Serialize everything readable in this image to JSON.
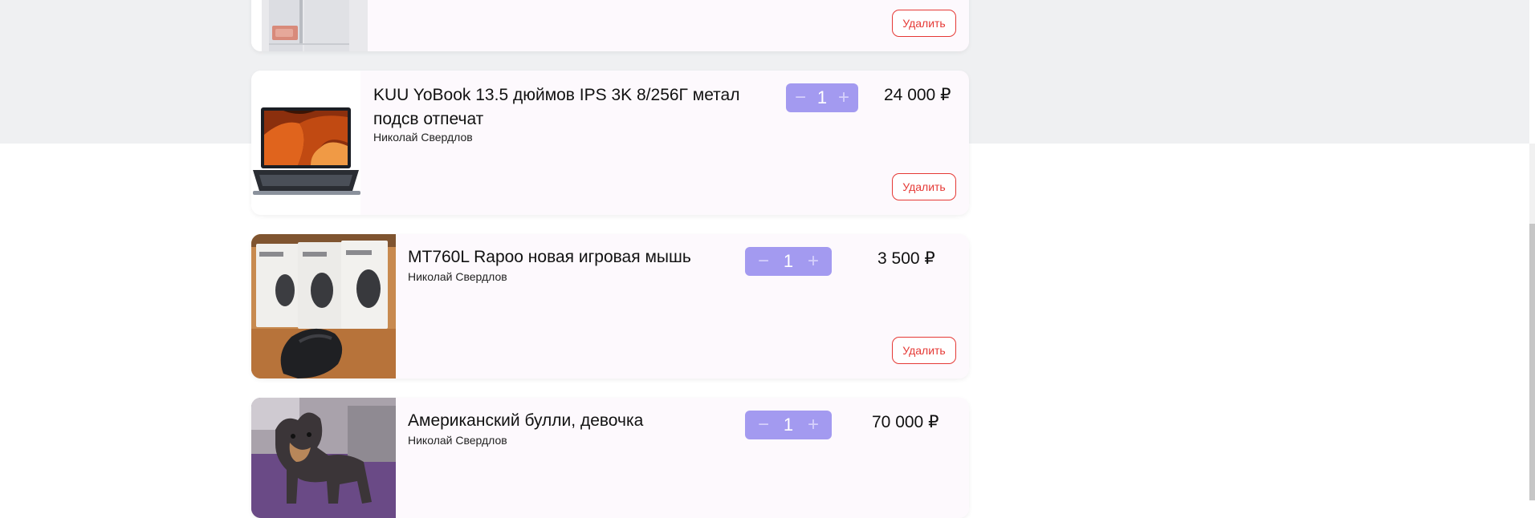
{
  "cart": {
    "items": [
      {
        "title": "",
        "seller": "",
        "quantity": "",
        "price": "",
        "delete_label": "Удалить"
      },
      {
        "title": "KUU YoBook 13.5 дюймов IPS 3K 8/256Г метал подсв отпечат",
        "seller": "Николай Свердлов",
        "quantity": "1",
        "price": "24 000 ₽",
        "delete_label": "Удалить"
      },
      {
        "title": "MT760L Rapoo новая игровая мышь",
        "seller": "Николай Свердлов",
        "quantity": "1",
        "price": "3 500 ₽",
        "delete_label": "Удалить"
      },
      {
        "title": "Американский булли, девочка",
        "seller": "Николай Свердлов",
        "quantity": "1",
        "price": "70 000 ₽",
        "delete_label": ""
      }
    ]
  },
  "icons": {
    "minus": "minus-icon",
    "plus": "plus-icon"
  },
  "colors": {
    "page_bg_top": "#eff0f2",
    "card_bg": "#fdf9fd",
    "qty_bg": "#a39af0",
    "delete_accent": "#e53935"
  }
}
